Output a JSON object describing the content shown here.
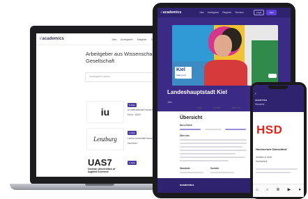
{
  "laptop": {
    "brand": "academics",
    "nav": [
      "Jobs",
      "Arbeitgeber",
      "Ratgeber",
      "Services"
    ],
    "headline_line1": "Arbeitgeber aus Wissenschaft, Fo",
    "headline_line2": "Gesellschaft",
    "search_placeholder": "Arbeitgeber suchen",
    "cards": [
      {
        "logo": "iu",
        "tag": "8 Jobs",
        "line1": "IU Internationale Hochsch.",
        "line2": "Erfurt · 1500+"
      },
      {
        "logo": "Lenzburg",
        "tag": "3 Jobs",
        "line1": "Leibniz Universität Hannover",
        "line2": "Hannover"
      },
      {
        "logo": "UAS7",
        "logo_sub": "German Universities of Applied Sciences",
        "tag": "2 Jobs",
        "line1": "",
        "line2": ""
      }
    ]
  },
  "tablet": {
    "brand": "academics",
    "nav": [
      "Jobs",
      "Arbeitgeber",
      "Ratgeber",
      "Services"
    ],
    "nav_buttons": [
      "Login",
      "Jobs"
    ],
    "hero_badge": "Kiel",
    "hero_badge_sub": "Sailing.City.",
    "title": "Landeshauptstadt Kiel",
    "subtitle": "Jobs",
    "tabs": [
      "Übersicht",
      "Jobs",
      "Kontakt",
      "Über uns"
    ],
    "overview_heading": "Übersicht",
    "section_headings": [
      "Kurz-Check",
      "Über uns",
      "Standorte",
      "Kontakt"
    ],
    "footer_brand": "academics"
  },
  "phone": {
    "title": "academics",
    "subtitle": "Startseite",
    "employer_logo": "HSD",
    "company": "Hochschule Düsseldorf",
    "text_line1": "Arbeiten in einer",
    "text_line2": "Hochschule",
    "nav_icons": [
      "home-icon",
      "search-icon",
      "plus-icon",
      "reels-icon",
      "profile-icon"
    ]
  },
  "colors": {
    "brand_purple": "#3b2a86",
    "dark_purple": "#2f226f",
    "accent": "#5b3fd6",
    "hsd_red": "#e2231a"
  }
}
